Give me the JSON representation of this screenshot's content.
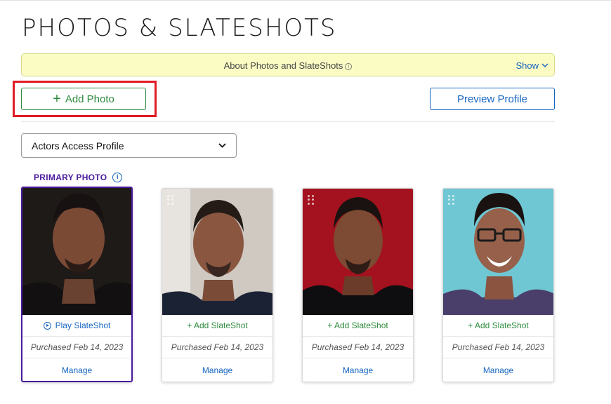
{
  "page": {
    "title": "PHOTOS & SLATESHOTS"
  },
  "about": {
    "text": "About Photos and SlateShots",
    "info_icon": "info-icon",
    "show_label": "Show"
  },
  "actions": {
    "add_photo_label": "Add Photo",
    "preview_profile_label": "Preview Profile"
  },
  "profile_select": {
    "selected": "Actors Access Profile"
  },
  "primary": {
    "label": "PRIMARY PHOTO"
  },
  "cards": [
    {
      "slateshot": "Play SlateShot",
      "purchased": "Purchased Feb 14, 2023",
      "manage": "Manage",
      "bg": "#1e1a18"
    },
    {
      "slateshot": "+ Add SlateShot",
      "purchased": "Purchased Feb 14, 2023",
      "manage": "Manage",
      "bg": "#cfc9c2"
    },
    {
      "slateshot": "+ Add SlateShot",
      "purchased": "Purchased Feb 14, 2023",
      "manage": "Manage",
      "bg": "#a3121e"
    },
    {
      "slateshot": "+ Add SlateShot",
      "purchased": "Purchased Feb 14, 2023",
      "manage": "Manage",
      "bg": "#6fc7d3"
    }
  ],
  "colors": {
    "green": "#2e8b3d",
    "blue": "#1565c0",
    "purple": "#4a1a9e",
    "highlight_red": "#e01b24",
    "about_bg": "#fbfcc4"
  }
}
